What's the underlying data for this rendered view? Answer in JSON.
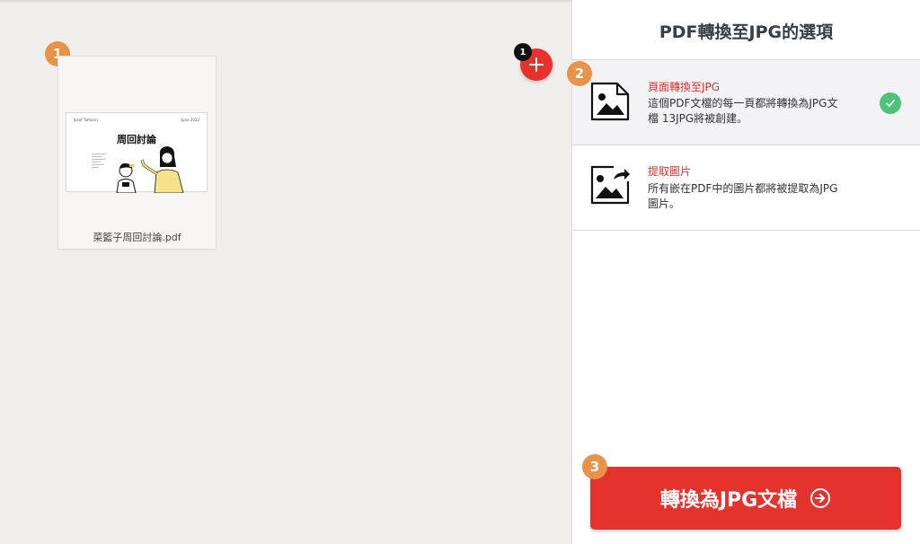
{
  "steps": {
    "one": "1",
    "two": "2",
    "three": "3"
  },
  "workspace": {
    "file": {
      "name": "菜籃子周回討論.pdf",
      "thumb_title": "周回討論",
      "thumb_brand": "Ipsof Tamarin",
      "thumb_date": "June 2022"
    },
    "add_button": {
      "count": "1",
      "icon": "plus-icon"
    }
  },
  "panel": {
    "title": "PDF轉換至JPG的選項",
    "options": [
      {
        "title": "頁面轉換至JPG",
        "desc_line1": "這個PDF文檔的每一頁都將轉換為JPG文",
        "desc_line2": "檔 13JPG將被創建。",
        "icon": "image-icon",
        "selected": true
      },
      {
        "title": "提取圖片",
        "desc_line1": "所有嵌在PDF中的圖片都將被提取為JPG",
        "desc_line2": "圖片。",
        "icon": "image-export-icon",
        "selected": false
      }
    ]
  },
  "convert_button": {
    "label": "轉換為JPG文檔",
    "icon": "arrow-circle-right-icon"
  },
  "colors": {
    "accent": "#e5322d",
    "step_badge": "#e8924a",
    "check": "#4dc37a"
  }
}
